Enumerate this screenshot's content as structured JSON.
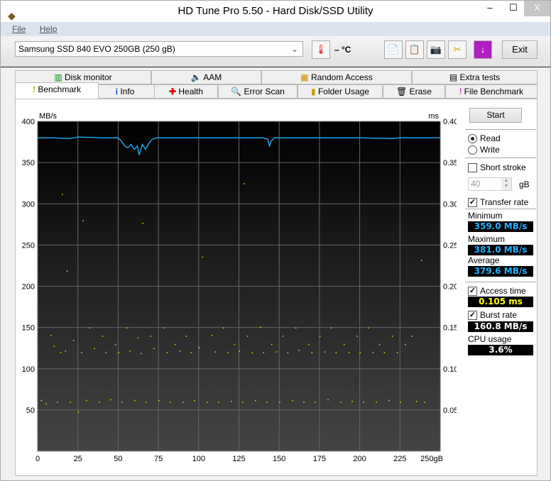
{
  "window": {
    "title": "HD Tune Pro 5.50 - Hard Disk/SSD Utility",
    "minimize": "–",
    "maximize": "☐",
    "close": "X"
  },
  "menu": [
    "File",
    "Help"
  ],
  "toolbar": {
    "drive": "Samsung SSD 840 EVO 250GB (250 gB)",
    "temperature": "– °C",
    "exit": "Exit"
  },
  "tabs_top": [
    "Disk monitor",
    "AAM",
    "Random Access",
    "Extra tests"
  ],
  "tabs_bottom": [
    "Benchmark",
    "Info",
    "Health",
    "Error Scan",
    "Folder Usage",
    "Erase",
    "File Benchmark"
  ],
  "side": {
    "start": "Start",
    "read": "Read",
    "write": "Write",
    "short_stroke": "Short stroke",
    "stroke_value": "40",
    "stroke_unit": "gB",
    "transfer_rate": "Transfer rate",
    "minimum_label": "Minimum",
    "minimum": "359.0 MB/s",
    "maximum_label": "Maximum",
    "maximum": "381.0 MB/s",
    "average_label": "Average",
    "average": "379.6 MB/s",
    "access_time": "Access time",
    "access_value": "0.105 ms",
    "burst_rate": "Burst rate",
    "burst_value": "160.8 MB/s",
    "cpu_label": "CPU usage",
    "cpu_value": "3.6%"
  },
  "colors": {
    "transfer": "#1ea0e6",
    "access": "#e6e600",
    "value_blue": "#1eb4ff",
    "value_yellow": "#ffff00"
  },
  "chart_data": {
    "type": "line+scatter",
    "ylabel_left": "MB/s",
    "ylabel_right": "ms",
    "xunit": "gB",
    "xlim": [
      0,
      250
    ],
    "ylim_left": [
      0,
      400
    ],
    "ylim_right": [
      0,
      0.4
    ],
    "xticks": [
      "0",
      "25",
      "50",
      "75",
      "100",
      "125",
      "150",
      "175",
      "200",
      "225",
      "250gB"
    ],
    "yticks_left": [
      "50",
      "100",
      "150",
      "200",
      "250",
      "300",
      "350",
      "400"
    ],
    "yticks_right": [
      "0.05",
      "0.10",
      "0.15",
      "0.20",
      "0.25",
      "0.30",
      "0.35",
      "0.40"
    ],
    "grid": true,
    "transfer_rate": [
      [
        0,
        380
      ],
      [
        10,
        380
      ],
      [
        20,
        379
      ],
      [
        25,
        381
      ],
      [
        40,
        380
      ],
      [
        50,
        380
      ],
      [
        52,
        376
      ],
      [
        54,
        370
      ],
      [
        56,
        368
      ],
      [
        58,
        372
      ],
      [
        60,
        366
      ],
      [
        62,
        370
      ],
      [
        63,
        359
      ],
      [
        65,
        372
      ],
      [
        67,
        366
      ],
      [
        69,
        373
      ],
      [
        71,
        378
      ],
      [
        74,
        380
      ],
      [
        100,
        380
      ],
      [
        140,
        380
      ],
      [
        143,
        378
      ],
      [
        144,
        370
      ],
      [
        145,
        376
      ],
      [
        147,
        380
      ],
      [
        200,
        380
      ],
      [
        220,
        379
      ],
      [
        225,
        380
      ],
      [
        250,
        380
      ]
    ],
    "access_time_ms": [
      [
        2,
        0.062
      ],
      [
        5,
        0.058
      ],
      [
        8,
        0.141
      ],
      [
        10,
        0.128
      ],
      [
        12,
        0.06
      ],
      [
        14,
        0.12
      ],
      [
        15,
        0.312
      ],
      [
        17,
        0.122
      ],
      [
        18,
        0.219
      ],
      [
        20,
        0.06
      ],
      [
        22,
        0.135
      ],
      [
        25,
        0.048
      ],
      [
        27,
        0.12
      ],
      [
        28,
        0.28
      ],
      [
        30,
        0.062
      ],
      [
        32,
        0.15
      ],
      [
        35,
        0.125
      ],
      [
        38,
        0.06
      ],
      [
        40,
        0.14
      ],
      [
        42,
        0.12
      ],
      [
        45,
        0.063
      ],
      [
        48,
        0.13
      ],
      [
        50,
        0.12
      ],
      [
        52,
        0.06
      ],
      [
        55,
        0.15
      ],
      [
        57,
        0.122
      ],
      [
        60,
        0.062
      ],
      [
        62,
        0.138
      ],
      [
        64,
        0.119
      ],
      [
        65,
        0.277
      ],
      [
        67,
        0.06
      ],
      [
        70,
        0.14
      ],
      [
        72,
        0.125
      ],
      [
        75,
        0.062
      ],
      [
        78,
        0.15
      ],
      [
        80,
        0.12
      ],
      [
        82,
        0.06
      ],
      [
        85,
        0.13
      ],
      [
        88,
        0.122
      ],
      [
        90,
        0.06
      ],
      [
        92,
        0.14
      ],
      [
        95,
        0.12
      ],
      [
        97,
        0.062
      ],
      [
        100,
        0.126
      ],
      [
        102,
        0.236
      ],
      [
        105,
        0.06
      ],
      [
        108,
        0.141
      ],
      [
        110,
        0.121
      ],
      [
        112,
        0.06
      ],
      [
        115,
        0.15
      ],
      [
        118,
        0.12
      ],
      [
        120,
        0.061
      ],
      [
        122,
        0.13
      ],
      [
        125,
        0.122
      ],
      [
        127,
        0.06
      ],
      [
        128,
        0.325
      ],
      [
        130,
        0.14
      ],
      [
        133,
        0.12
      ],
      [
        135,
        0.062
      ],
      [
        138,
        0.151
      ],
      [
        140,
        0.12
      ],
      [
        142,
        0.06
      ],
      [
        145,
        0.13
      ],
      [
        148,
        0.121
      ],
      [
        150,
        0.06
      ],
      [
        152,
        0.14
      ],
      [
        155,
        0.12
      ],
      [
        158,
        0.062
      ],
      [
        160,
        0.15
      ],
      [
        162,
        0.123
      ],
      [
        165,
        0.06
      ],
      [
        168,
        0.13
      ],
      [
        170,
        0.12
      ],
      [
        172,
        0.06
      ],
      [
        175,
        0.14
      ],
      [
        178,
        0.121
      ],
      [
        180,
        0.063
      ],
      [
        182,
        0.15
      ],
      [
        185,
        0.12
      ],
      [
        188,
        0.06
      ],
      [
        190,
        0.13
      ],
      [
        193,
        0.12
      ],
      [
        195,
        0.061
      ],
      [
        198,
        0.14
      ],
      [
        200,
        0.12
      ],
      [
        202,
        0.06
      ],
      [
        205,
        0.15
      ],
      [
        208,
        0.12
      ],
      [
        210,
        0.06
      ],
      [
        212,
        0.13
      ],
      [
        215,
        0.12
      ],
      [
        218,
        0.062
      ],
      [
        220,
        0.14
      ],
      [
        223,
        0.12
      ],
      [
        225,
        0.06
      ],
      [
        228,
        0.13
      ],
      [
        232,
        0.14
      ],
      [
        235,
        0.061
      ],
      [
        238,
        0.232
      ],
      [
        240,
        0.06
      ]
    ]
  }
}
